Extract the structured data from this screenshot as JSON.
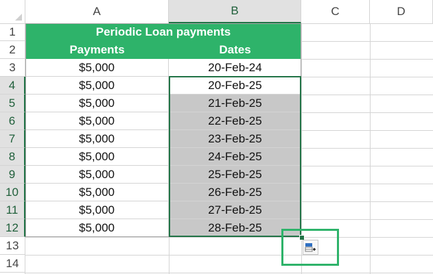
{
  "columns": [
    "A",
    "B",
    "C",
    "D"
  ],
  "rows": [
    "1",
    "2",
    "3",
    "4",
    "5",
    "6",
    "7",
    "8",
    "9",
    "10",
    "11",
    "12",
    "13",
    "14"
  ],
  "sheet": {
    "title": "Periodic Loan payments",
    "headers": {
      "payments": "Payments",
      "dates": "Dates"
    },
    "data": [
      {
        "payment": "$5,000",
        "date": "20-Feb-24"
      },
      {
        "payment": "$5,000",
        "date": "20-Feb-25"
      },
      {
        "payment": "$5,000",
        "date": "21-Feb-25"
      },
      {
        "payment": "$5,000",
        "date": "22-Feb-25"
      },
      {
        "payment": "$5,000",
        "date": "23-Feb-25"
      },
      {
        "payment": "$5,000",
        "date": "24-Feb-25"
      },
      {
        "payment": "$5,000",
        "date": "25-Feb-25"
      },
      {
        "payment": "$5,000",
        "date": "26-Feb-25"
      },
      {
        "payment": "$5,000",
        "date": "27-Feb-25"
      },
      {
        "payment": "$5,000",
        "date": "28-Feb-25"
      }
    ]
  },
  "selection": {
    "range": "B4:B12",
    "active_column": "B",
    "active_rows": [
      "4",
      "5",
      "6",
      "7",
      "8",
      "9",
      "10",
      "11",
      "12"
    ]
  },
  "colors": {
    "header_fill": "#2eb36a",
    "selection_outline": "#217346",
    "selected_date_fill": "#c8c8c8"
  },
  "icons": {
    "select_all": "select-all-triangle-icon",
    "autofill_options": "auto-fill-options-icon"
  }
}
